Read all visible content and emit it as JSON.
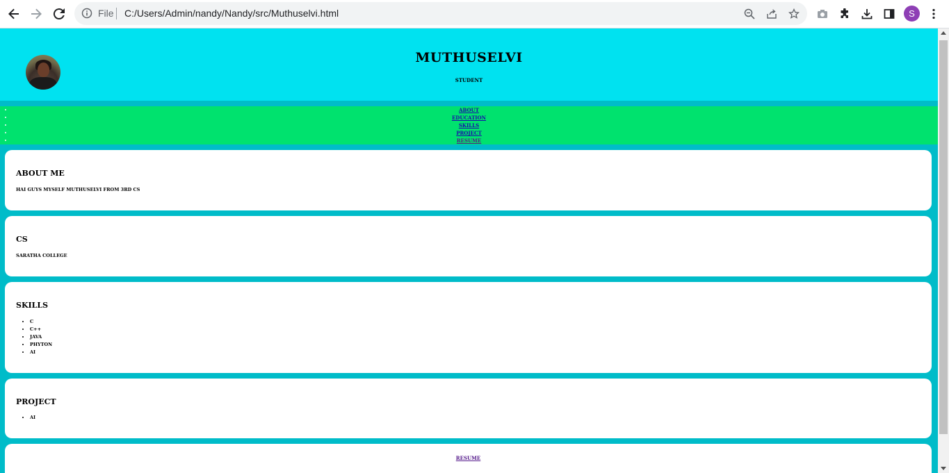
{
  "browser": {
    "url_scheme_label": "File",
    "url": "C:/Users/Admin/nandy/Nandy/src/Muthuselvi.html",
    "profile_initial": "S",
    "icons": [
      "back-arrow-icon",
      "forward-arrow-icon",
      "reload-icon",
      "info-icon",
      "zoom-icon",
      "share-icon",
      "star-icon",
      "camera-icon",
      "extensions-icon",
      "download-icon",
      "side-panel-icon",
      "kebab-menu-icon"
    ]
  },
  "header": {
    "name": "MUTHUSELVI",
    "role": "STUDENT"
  },
  "nav": {
    "items": [
      {
        "label": "ABOUT"
      },
      {
        "label": "EDUCATION"
      },
      {
        "label": "SKILLS"
      },
      {
        "label": "PROJECT"
      },
      {
        "label": "RESUME"
      }
    ]
  },
  "about": {
    "title": "ABOUT ME",
    "text": "HAI GUYS MYSELF MUTHUSELVI FROM 3RD CS"
  },
  "education": {
    "title": "CS",
    "text": "SARATHA COLLEGE"
  },
  "skills": {
    "title": "SKILLS",
    "items": [
      "C",
      "C++",
      "JAVA",
      "PHYTON",
      "AI"
    ]
  },
  "project": {
    "title": "PROJECT",
    "items": [
      "AI"
    ]
  },
  "resume": {
    "link_label": "RESUME"
  },
  "colors": {
    "header_bg": "#00e2f0",
    "nav_bg": "#00e26e",
    "page_bg": "#00bcc9",
    "card_bg": "#ffffff",
    "link": "#1a0dab",
    "visited_link": "#551a8b"
  }
}
